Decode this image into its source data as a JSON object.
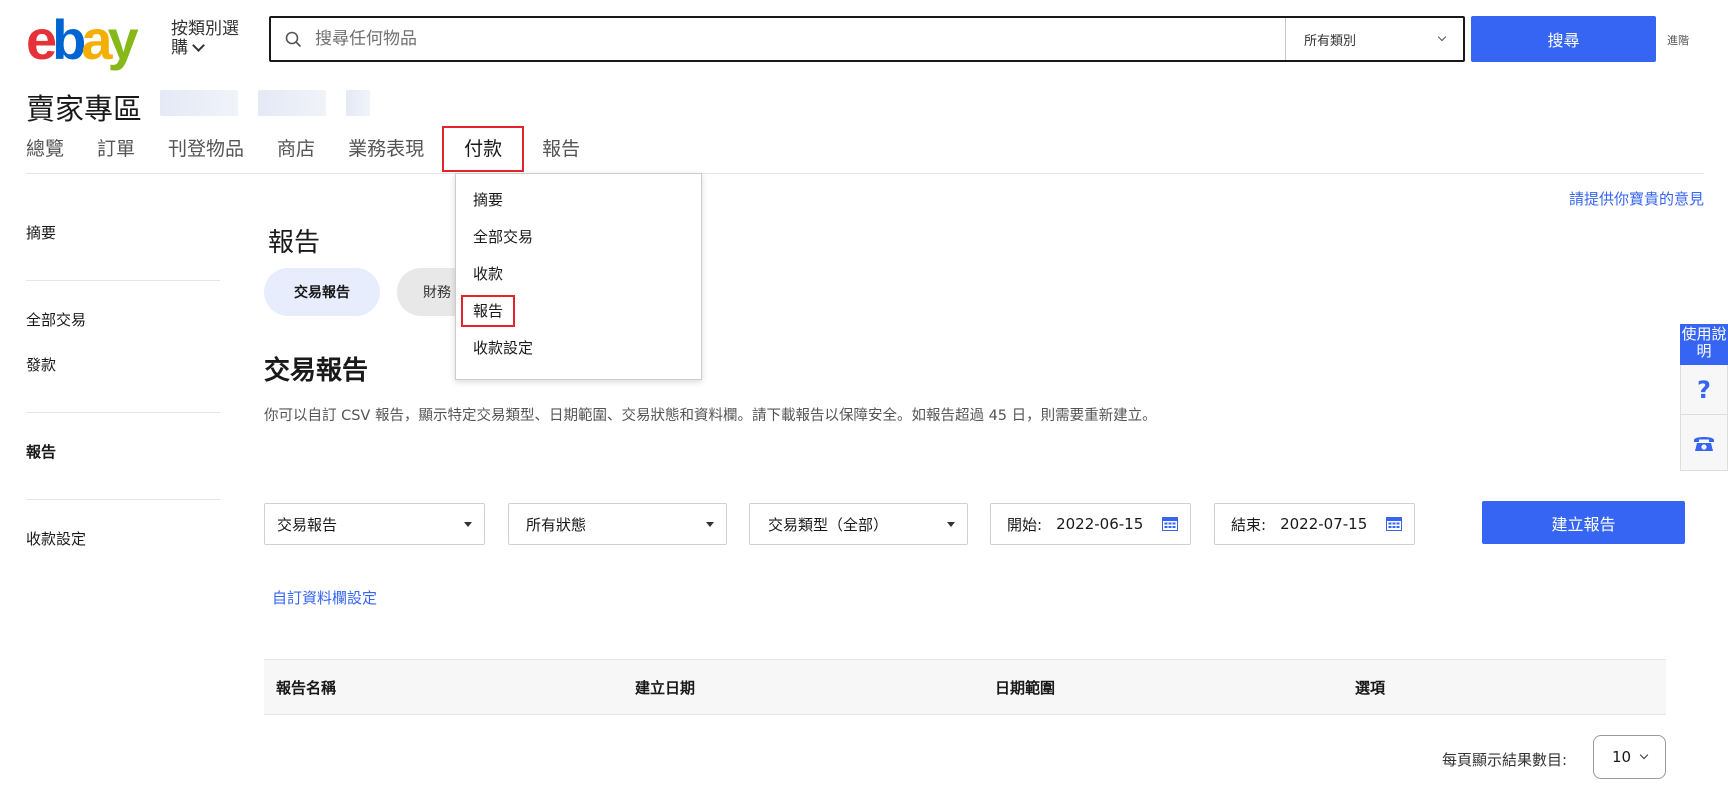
{
  "header": {
    "logo": {
      "e": "e",
      "b": "b",
      "a": "a",
      "y": "y"
    },
    "shop_by_category": "按類別選購",
    "search_placeholder": "搜尋任何物品",
    "category_select": "所有類別",
    "search_button": "搜尋",
    "advanced": "進階"
  },
  "hub": {
    "title": "賣家專區"
  },
  "topnav": {
    "items": [
      "總覽",
      "訂單",
      "刊登物品",
      "商店",
      "業務表現",
      "付款",
      "報告"
    ],
    "active": "付款"
  },
  "payments_dropdown": {
    "items": [
      "摘要",
      "全部交易",
      "收款",
      "報告",
      "收款設定"
    ],
    "highlighted": "報告"
  },
  "feedback_link": "請提供你寶貴的意見",
  "sidebar": {
    "items": [
      "摘要",
      "全部交易",
      "發款",
      "報告",
      "收款設定"
    ],
    "active": "報告"
  },
  "main": {
    "heading": "報告",
    "pills": [
      "交易報告",
      "財務"
    ],
    "section_title": "交易報告",
    "description": "你可以自訂 CSV 報告，顯示特定交易類型、日期範圍、交易狀態和資料欄。請下載報告以保障安全。如報告超過 45 日，則需要重新建立。",
    "filters": {
      "report_type": "交易報告",
      "status": "所有狀態",
      "transaction_type": "交易類型（全部）",
      "start_label": "開始:",
      "start_date": "2022-06-15",
      "end_label": "結束:",
      "end_date": "2022-07-15"
    },
    "create_button": "建立報告",
    "custom_columns_link": "自訂資料欄設定",
    "table_headers": [
      "報告名稱",
      "建立日期",
      "日期範圍",
      "選項"
    ],
    "per_page_label": "每頁顯示結果數目:",
    "per_page_value": "10"
  },
  "help": {
    "label": "使用說明",
    "question": "?"
  },
  "colors": {
    "accent": "#3665f3",
    "highlight_outline": "#e4232b"
  }
}
